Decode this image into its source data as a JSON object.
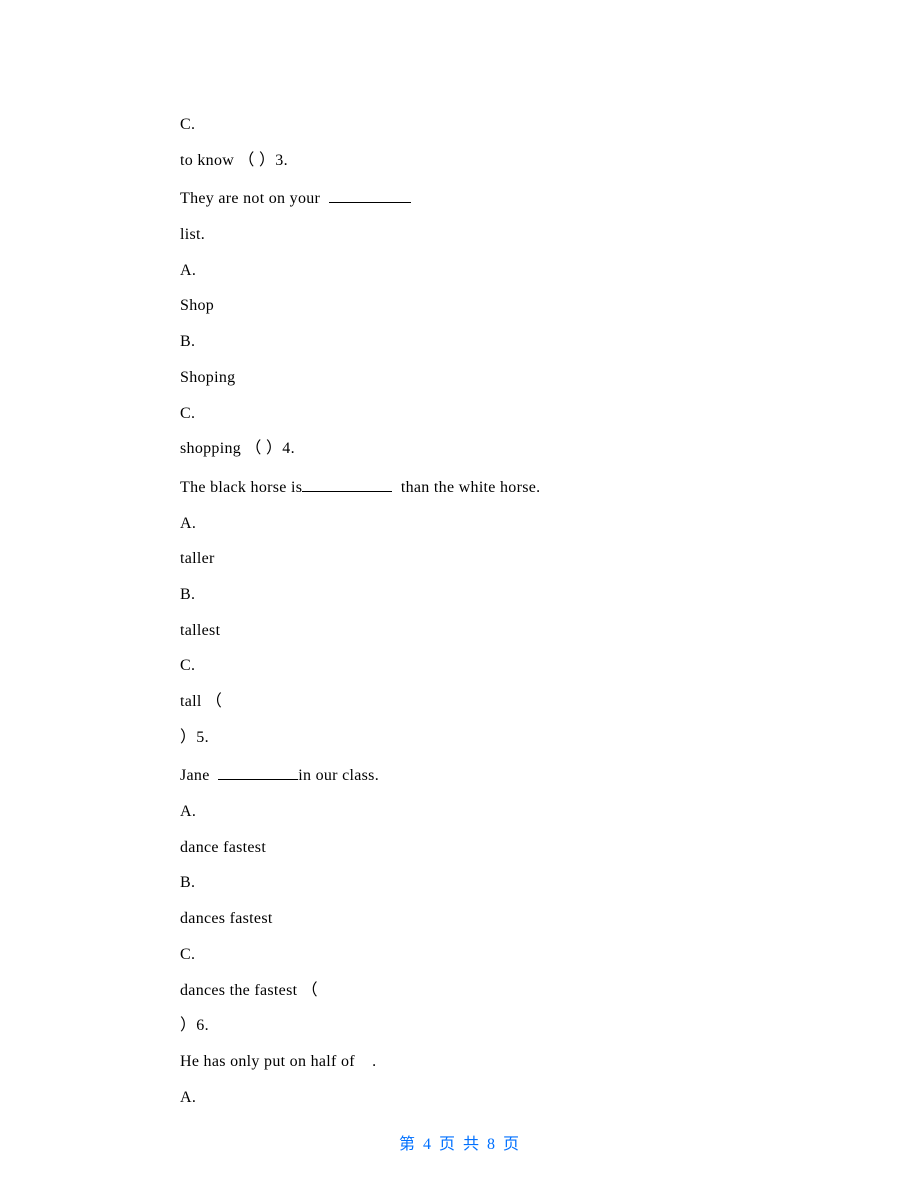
{
  "lines": [
    {
      "text": "C."
    },
    {
      "text": "to know （ ）3."
    },
    {
      "text": "They are not on your  ",
      "blank_width": 82
    },
    {
      "text": "list."
    },
    {
      "text": "A."
    },
    {
      "text": "Shop"
    },
    {
      "text": "B."
    },
    {
      "text": "Shoping"
    },
    {
      "text": "C."
    },
    {
      "text": "shopping （ ）4."
    },
    {
      "text": "The black horse is",
      "blank_width": 90,
      "after": "  than the white horse."
    },
    {
      "text": "A."
    },
    {
      "text": "taller"
    },
    {
      "text": "B."
    },
    {
      "text": "tallest"
    },
    {
      "text": "C."
    },
    {
      "text": "tall （"
    },
    {
      "text": "）5."
    },
    {
      "text": "Jane  ",
      "blank_width": 80,
      "after": "in our class."
    },
    {
      "text": "A."
    },
    {
      "text": "dance fastest"
    },
    {
      "text": "B."
    },
    {
      "text": "dances fastest"
    },
    {
      "text": "C."
    },
    {
      "text": "dances the fastest （"
    },
    {
      "text": "）6."
    },
    {
      "text": "He has only put on half of    ."
    },
    {
      "text": "A."
    }
  ],
  "footer": "第 4 页 共 8 页"
}
